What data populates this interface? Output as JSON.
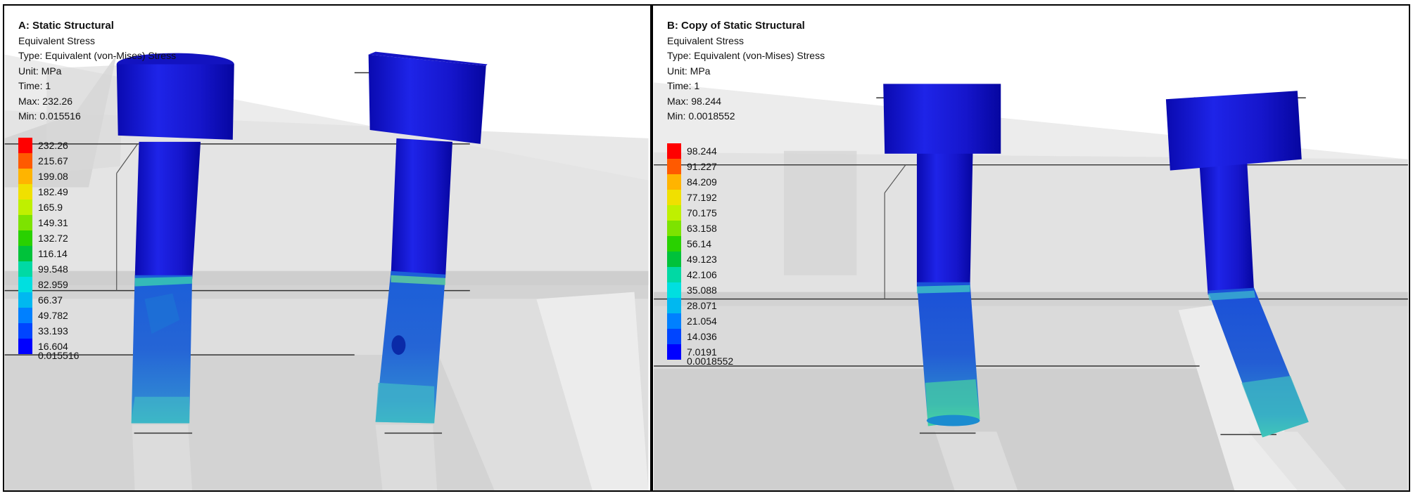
{
  "panels": [
    {
      "title": "A: Static Structural",
      "result": "Equivalent Stress",
      "type": "Type: Equivalent (von-Mises) Stress",
      "unit": "Unit: MPa",
      "time": "Time: 1",
      "max": "Max: 232.26",
      "min": "Min: 0.015516",
      "legend": [
        "232.26",
        "215.67",
        "199.08",
        "182.49",
        "165.9",
        "149.31",
        "132.72",
        "116.14",
        "99.548",
        "82.959",
        "66.37",
        "49.782",
        "33.193",
        "16.604",
        "0.015516"
      ]
    },
    {
      "title": "B: Copy of Static Structural",
      "result": "Equivalent Stress",
      "type": "Type: Equivalent (von-Mises) Stress",
      "unit": "Unit: MPa",
      "time": "Time: 1",
      "max": "Max: 98.244",
      "min": "Min: 0.0018552",
      "legend": [
        "98.244",
        "91.227",
        "84.209",
        "77.192",
        "70.175",
        "63.158",
        "56.14",
        "49.123",
        "42.106",
        "35.088",
        "28.071",
        "21.054",
        "14.036",
        "7.0191",
        "0.0018552"
      ]
    }
  ],
  "legend_colors": [
    "#ff0000",
    "#ff5a00",
    "#ffb400",
    "#f0e000",
    "#bff000",
    "#7de300",
    "#29d100",
    "#00c23a",
    "#00d9a4",
    "#00dfe0",
    "#00b8f0",
    "#0080ff",
    "#0045ff",
    "#0000ff"
  ],
  "bolt_color": "#1a1ad6"
}
